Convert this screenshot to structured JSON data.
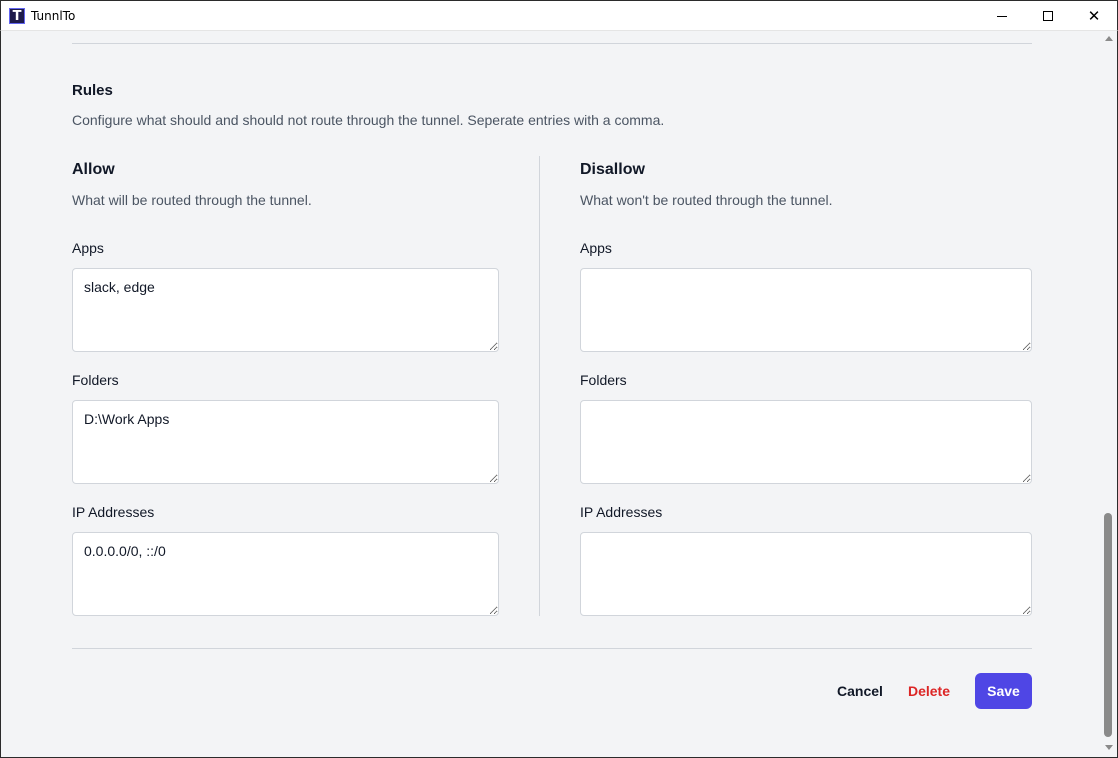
{
  "window": {
    "title": "TunnlTo",
    "icon_letter": "T",
    "icon": "app-logo-icon",
    "minimize_icon": "minimize-icon",
    "maximize_icon": "maximize-icon",
    "close_icon": "close-icon",
    "close_glyph": "✕"
  },
  "rules": {
    "title": "Rules",
    "description": "Configure what should and should not route through the tunnel. Seperate entries with a comma."
  },
  "allow": {
    "title": "Allow",
    "description": "What will be routed through the tunnel.",
    "apps_label": "Apps",
    "apps_value": "slack, edge",
    "folders_label": "Folders",
    "folders_value": "D:\\Work Apps",
    "ip_label": "IP Addresses",
    "ip_value": "0.0.0.0/0, ::/0"
  },
  "disallow": {
    "title": "Disallow",
    "description": "What won't be routed through the tunnel.",
    "apps_label": "Apps",
    "apps_value": "",
    "folders_label": "Folders",
    "folders_value": "",
    "ip_label": "IP Addresses",
    "ip_value": ""
  },
  "actions": {
    "cancel_label": "Cancel",
    "delete_label": "Delete",
    "save_label": "Save"
  },
  "colors": {
    "accent": "#4f46e5",
    "danger": "#dc2626",
    "background": "#f3f4f6"
  }
}
